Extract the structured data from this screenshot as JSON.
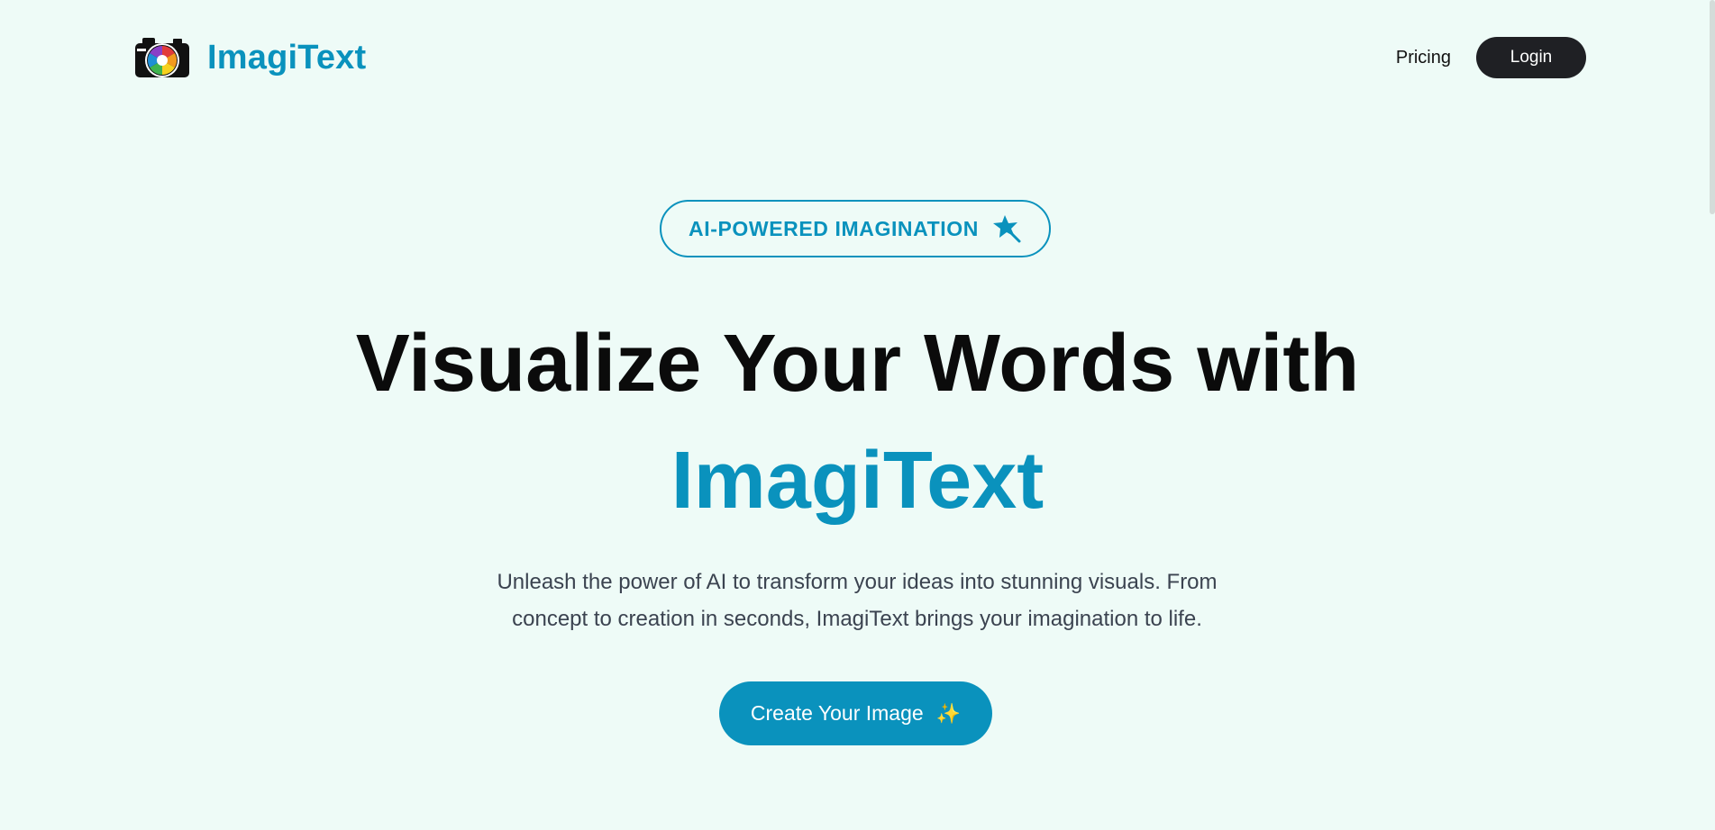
{
  "header": {
    "brand_name": "ImagiText",
    "logo_icon": "camera-aperture-icon",
    "nav": {
      "pricing_label": "Pricing",
      "login_label": "Login"
    }
  },
  "hero": {
    "badge_label": "AI-POWERED IMAGINATION",
    "badge_icon": "magic-star-icon",
    "headline_line1": "Visualize Your Words with",
    "headline_line2": "ImagiText",
    "subtitle": "Unleash the power of AI to transform your ideas into stunning visuals. From concept to creation in seconds, ImagiText brings your imagination to life.",
    "cta_label": "Create Your Image",
    "cta_icon": "sparkles-icon",
    "cta_icon_glyph": "✨"
  },
  "colors": {
    "background": "#eefbf7",
    "accent": "#0a92bd",
    "dark_button": "#1f2024",
    "headline": "#0b0b0b",
    "subtitle": "#3b4350"
  }
}
